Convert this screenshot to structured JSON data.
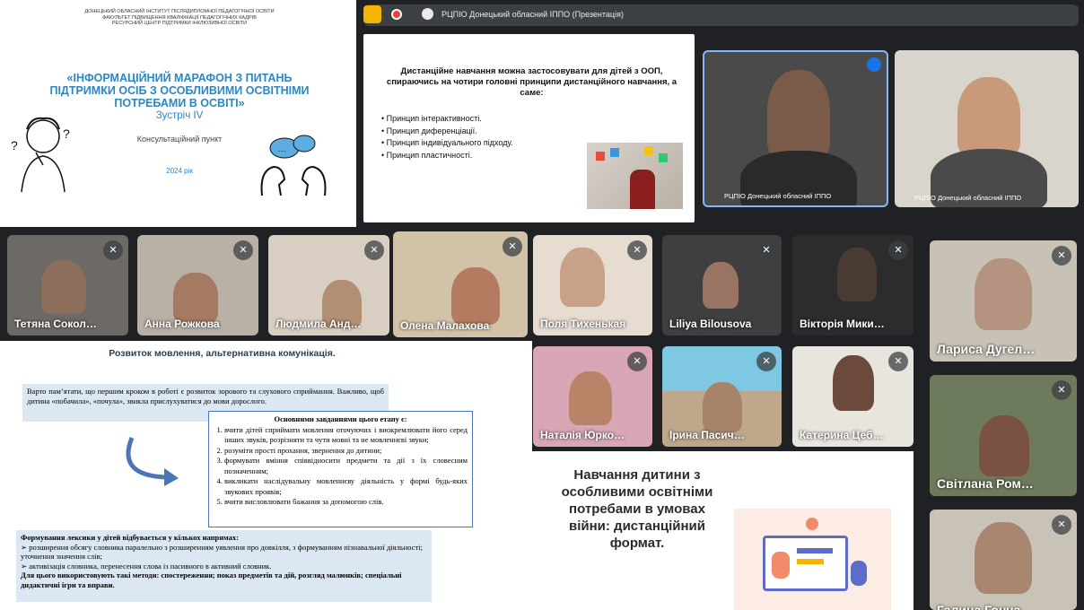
{
  "title_slide": {
    "institution": [
      "ДОНЕЦЬКИЙ ОБЛАСНИЙ ІНСТИТУТ ПІСЛЯДИПЛОМНОЇ ПЕДАГОГІЧНОЇ ОСВІТИ",
      "ФАКУЛЬТЕТ ПІДВИЩЕННЯ КВАЛІФІКАЦІЇ ПЕДАГОГІЧНИХ КАДРІВ",
      "РЕСУРСНИЙ ЦЕНТР ПІДТРИМКИ ІНКЛЮЗИВНОЇ ОСВІТИ"
    ],
    "title": "«ІНФОРМАЦІЙНИЙ МАРАФОН З ПИТАНЬ ПІДТРИМКИ ОСІБ З ОСОБЛИВИМИ ОСВІТНІМИ ПОТРЕБАМИ В ОСВІТІ»",
    "meeting": "Зустріч IV",
    "consult": "Консультаційний пункт",
    "year": "2024 рік"
  },
  "topbar": {
    "presentation_label": "РЦПІО Донецький обласний ІППО (Презентація)"
  },
  "shared_slide": {
    "title": "Дистанційне навчання можна застосовувати для дітей з ООП, спираючись на чотири головні принципи дистанційного навчання, а саме:",
    "items": [
      "• Принцип інтерактивності.",
      "• Принцип диференціації.",
      "• Принцип індивідуального підходу.",
      "• Принцип пластичності."
    ]
  },
  "host_tiles": [
    {
      "label": "РЦПІО Донецький обласний ІППО"
    },
    {
      "label": "РЦПІО Донецький обласний ІППО"
    }
  ],
  "participants": [
    "Тетяна Сокол…",
    "Анна Рожкова",
    "Людмила Анд…",
    "Олена Малахова",
    "Поля Тихенькая",
    "Liliya Bilousova",
    "Вікторія Мики…",
    "Лариса Дугел…",
    "Наталія Юрко…",
    "Ірина Пасич…",
    "Катерина Цеб…",
    "Світлана Ром…",
    "Галина Гонча…"
  ],
  "speech_slide": {
    "title": "Розвиток мовлення, альтернативна комунікація.",
    "note": "Варто пам’ятати, що першим кроком в роботі є розвиток зорового та слухового сприймання. Важливо, щоб дитина «побачила», «почула», звикла прислухуватися до мови дорослого.",
    "box_title": "Основними завданнями цього етапу є:",
    "box_items": [
      "вчити дітей сприймати мовлення оточуючих і виокремлювати його серед інших звуків, розрізняти та чути мовні та не мовленнєві звуки;",
      "розуміти прості прохання, звернення до дитини;",
      "формувати вміння співвідносити предмети та дії з їх словесним позначенням;",
      "викликати наслідувальну мовленнєву діяльність у формі будь-яких звукових проявів;",
      "вчити висловлювати бажання за допомогою слів."
    ],
    "bottom_title": "Формування лексики у дітей відбувається у кількох напрямах:",
    "bottom_items": [
      "➢ розширення обсягу словника паралельно з розширенням уявлення про довкілля, з формуванням пізнавальної діяльності; уточнення значення слів;",
      "➢ активізація словника, перенесення слова із пасивного в активний словник."
    ],
    "bottom_methods": "Для цього використовують такі методи: спостереження; показ предметів та дій, розгляд малюнків; спеціальні дидактичні ігри та вправи."
  },
  "war_slide": {
    "title": "Навчання дитини з особливими освітніми потребами в умовах війни: дистанційний формат."
  }
}
